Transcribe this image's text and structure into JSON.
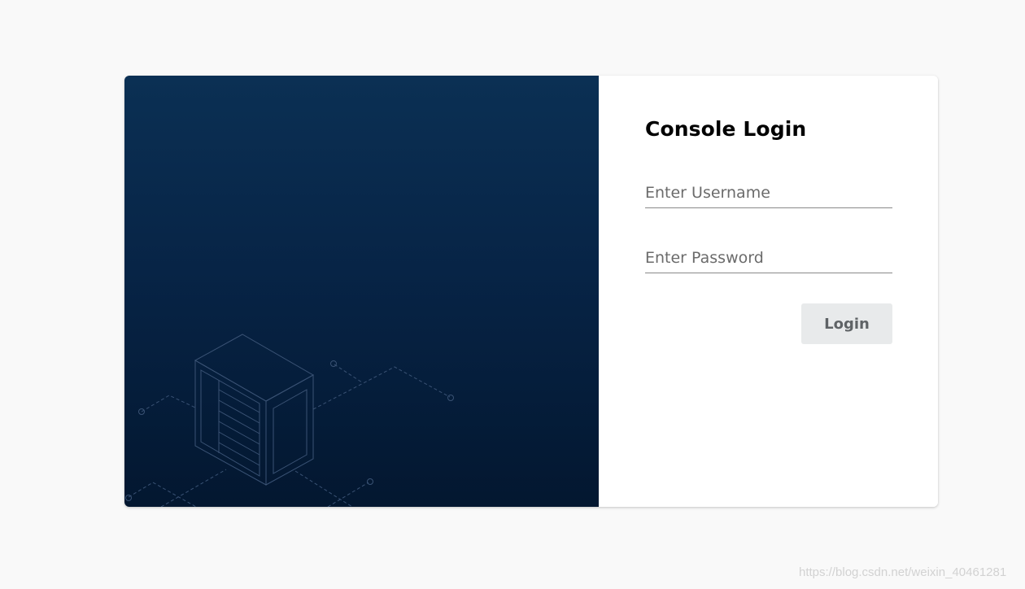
{
  "login": {
    "title": "Console Login",
    "username_placeholder": "Enter Username",
    "password_placeholder": "Enter Password",
    "login_label": "Login"
  },
  "watermark": "https://blog.csdn.net/weixin_40461281",
  "colors": {
    "page_background": "#f9f9f9",
    "panel_gradient_top": "#0b3054",
    "panel_gradient_bottom": "#031730",
    "button_background": "#e8eaeb",
    "button_text": "#5f6366"
  },
  "icons": {
    "illustration": "server-rack-network-illustration"
  }
}
